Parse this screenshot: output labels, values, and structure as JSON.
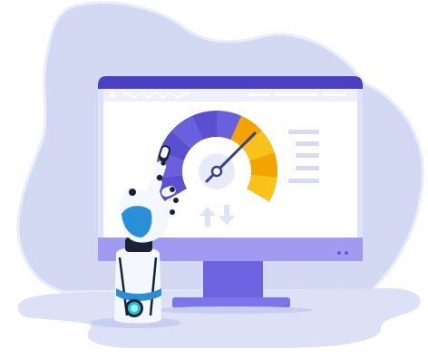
{
  "illustration": {
    "subject": "robot-hand-pointing-at-speed-gauge-on-monitor",
    "gauge": {
      "segments_total": 10,
      "segments_highlighted": 4
    },
    "icons": [
      "up-arrow-icon",
      "down-arrow-icon",
      "menu-lines-icon",
      "gauge-needle-icon"
    ],
    "colors": {
      "blob": "#d3d8f3",
      "blob_outline": "#e7eaf8",
      "ground": "#dde1f6",
      "monitor_bar": "#5a4fd0",
      "monitor_bezel": "#dfe3f8",
      "monitor_chin": "#a09af0",
      "stand": "#6b63e0",
      "gauge_purple": "#6a60dd",
      "gauge_purple_dark": "#5a50cf",
      "gauge_orange": "#f3a400",
      "gauge_orange_light": "#f8c21a",
      "robot_blue": "#2a8fd6",
      "robot_dark": "#1a2336",
      "robot_white": "#f4f7fc",
      "button_teal": "#29c3c9"
    }
  }
}
